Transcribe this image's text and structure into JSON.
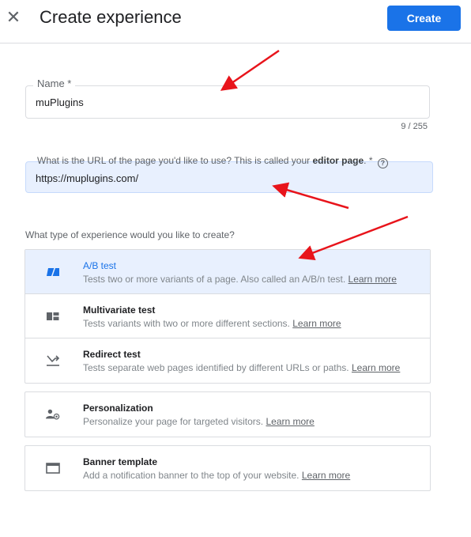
{
  "header": {
    "title": "Create experience",
    "create_label": "Create",
    "close_icon": "close-icon"
  },
  "name_field": {
    "label": "Name *",
    "value": "muPlugins",
    "counter": "9 / 255"
  },
  "url_field": {
    "label_prefix": "What is the URL of the page you'd like to use? This is called your",
    "label_bold": "editor page",
    "label_suffix": ". *",
    "help_icon": "?",
    "value": "https://muplugins.com/"
  },
  "question": "What type of experience would you like to create?",
  "options": [
    {
      "title": "A/B test",
      "description": "Tests two or more variants of a page. Also called an A/B/n test.",
      "learn_more": "Learn more",
      "icon": "ab-test-icon",
      "selected": true
    },
    {
      "title": "Multivariate test",
      "description": "Tests variants with two or more different sections.",
      "learn_more": "Learn more",
      "icon": "multivariate-icon",
      "selected": false
    },
    {
      "title": "Redirect test",
      "description": "Tests separate web pages identified by different URLs or paths.",
      "learn_more": "Learn more",
      "icon": "redirect-icon",
      "selected": false
    },
    {
      "title": "Personalization",
      "description": "Personalize your page for targeted visitors.",
      "learn_more": "Learn more",
      "icon": "personalization-icon",
      "selected": false
    },
    {
      "title": "Banner template",
      "description": "Add a notification banner to the top of your website.",
      "learn_more": "Learn more",
      "icon": "banner-icon",
      "selected": false
    }
  ],
  "colors": {
    "accent": "#1a73e8",
    "selected_bg": "#e8f0fe",
    "annotation_arrow": "#e8141b"
  }
}
